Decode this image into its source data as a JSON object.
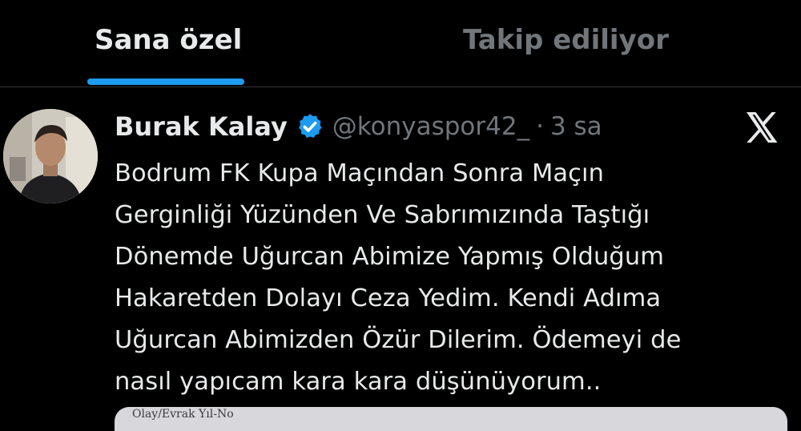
{
  "tabs": [
    {
      "label": "Sana özel",
      "active": true
    },
    {
      "label": "Takip ediliyor",
      "active": false
    }
  ],
  "post": {
    "author": {
      "name": "Burak Kalay",
      "handle": "@konyaspor42_",
      "verified": true
    },
    "separator": "·",
    "time": "3 sa",
    "text_lines": [
      "Bodrum FK Kupa Maçından Sonra Maçın",
      "Gerginliği Yüzünden Ve Sabrımızında Taştığı",
      "Dönemde Uğurcan Abimize Yapmış Olduğum",
      "Hakaretden Dolayı Ceza Yedim. Kendi Adıma",
      "Uğurcan Abimizden Özür Dilerim. Ödemeyi de",
      "nasıl yapıcam kara kara düşünüyorum.."
    ],
    "media_text": "Olay/Evrak Yıl-No"
  },
  "colors": {
    "background": "#000000",
    "text": "#e7e9ea",
    "muted": "#71767b",
    "accent": "#1d9bf0",
    "divider": "#2f3336"
  },
  "icons": {
    "verified": "verified-badge-icon",
    "logo": "x-logo-icon"
  }
}
